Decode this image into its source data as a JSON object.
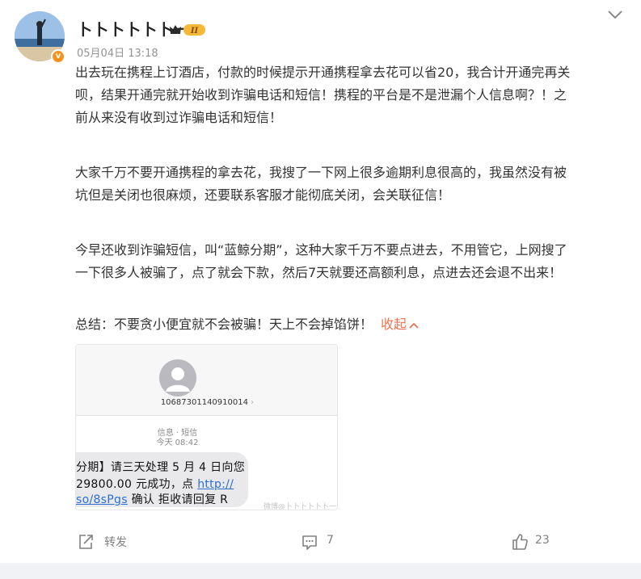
{
  "user": {
    "name": "卜卜卜卜卜卜一",
    "verified_mark": "v",
    "badge_text": "II",
    "badge_color": "#f5b93a",
    "time": "05月04日 13:18"
  },
  "post": {
    "paragraphs": [
      "出去玩在携程上订酒店，付款的时候提示开通携程拿去花可以省20，我合计开通完再关",
      "呗，结果开通完就开始收到诈骗电话和短信！携程的平台是不是泄漏个人信息啊？！之",
      "前从来没有收到过诈骗电话和短信！",
      "大家千万不要开通携程的拿去花，我搜了一下网上很多逾期利息很高的，我虽然没有被",
      "坑但是关闭也很麻烦，还要联系客服才能彻底关闭，会关联征信！",
      "今早还收到诈骗短信，叫“蓝鲸分期”，这种大家千万不要点进去，不用管它，上网搜了",
      "一下很多人被骗了，点了就会下款，然后7天就要还高额利息，点进去还会退不出来！",
      "总结：不要贪小便宜就不会被骗！天上不会掉馅饼！"
    ],
    "collapse_label": "收起",
    "accent_color": "#eb7350"
  },
  "sms": {
    "number": "10687301140910014",
    "meta_line1": "信息 · 短信",
    "meta_line2": "今天 08:42",
    "line1": "分期】请三天处理 5 月 4 日向您",
    "line2_text": "29800.00 元成功，点 ",
    "line2_link": "http://",
    "line3_link": "so/8sPgs",
    "line3_text": " 确认 拒收请回复 R",
    "watermark": "微博@卜卜卜卜卜卜一"
  },
  "actions": {
    "repost_label": "转发",
    "comment_count": "7",
    "like_count": "23"
  },
  "icons": {
    "collapse": "chevron-down-icon",
    "repost": "repost-icon",
    "comment": "comment-icon",
    "like": "thumbs-up-icon"
  }
}
